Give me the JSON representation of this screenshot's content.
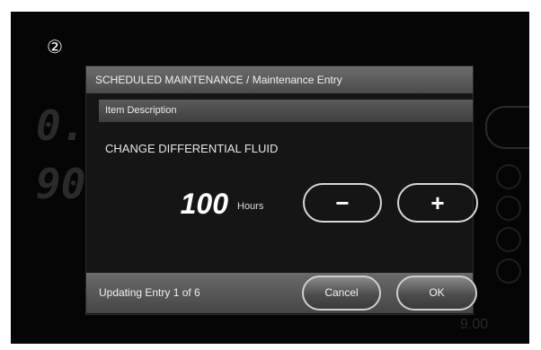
{
  "callout": "②",
  "dialog": {
    "title": "SCHEDULED MAINTENANCE / Maintenance Entry",
    "description_label": "Item Description",
    "item_name": "CHANGE DIFFERENTIAL FLUID",
    "value": "100",
    "unit": "Hours",
    "minus_label": "−",
    "plus_label": "+",
    "status": "Updating Entry 1 of 6",
    "cancel_label": "Cancel",
    "ok_label": "OK"
  },
  "colors": {
    "screen_bg": "#050505",
    "dialog_bg": "#151515",
    "title_bar": "#5a5a5a",
    "button_border": "#d8d8d8"
  },
  "icons": [
    "minus-icon",
    "plus-icon"
  ]
}
